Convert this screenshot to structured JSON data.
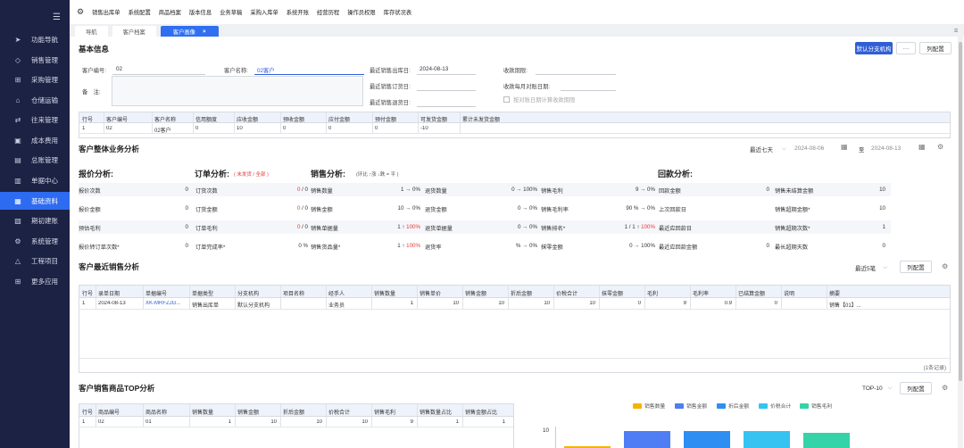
{
  "sidebar": {
    "menu_icon": "hamburger-icon",
    "items": [
      {
        "label": "功能导航",
        "icon": "navigate-icon"
      },
      {
        "label": "销售管理",
        "icon": "tag-icon"
      },
      {
        "label": "采购管理",
        "icon": "cart-icon"
      },
      {
        "label": "仓储运输",
        "icon": "warehouse-icon"
      },
      {
        "label": "往来管理",
        "icon": "transfer-icon"
      },
      {
        "label": "成本费用",
        "icon": "cost-icon"
      },
      {
        "label": "总账管理",
        "icon": "ledger-icon"
      },
      {
        "label": "单据中心",
        "icon": "document-icon"
      },
      {
        "label": "基础资料",
        "icon": "data-icon"
      },
      {
        "label": "期初建账",
        "icon": "opening-icon"
      },
      {
        "label": "系统管理",
        "icon": "settings-icon"
      },
      {
        "label": "工程项目",
        "icon": "project-icon"
      },
      {
        "label": "更多应用",
        "icon": "apps-icon"
      }
    ]
  },
  "topmenu": [
    "销售出库单",
    "系统配置",
    "商品档案",
    "版本信息",
    "业务草稿",
    "采购入库单",
    "系统开账",
    "经营历程",
    "操作员权限",
    "库存状况表"
  ],
  "tabs": [
    {
      "label": "导航"
    },
    {
      "label": "客户档案"
    },
    {
      "label": "客户画像",
      "close": "×"
    }
  ],
  "basic": {
    "title": "基本信息",
    "btn_default": "默认分支机构",
    "btn_more": "···",
    "btn_columns": "列配置",
    "customer_no_label": "客户编号:",
    "customer_no": "02",
    "customer_name_label": "客户名称:",
    "customer_name": "02客户",
    "memo_label": "备　注:",
    "last_out_label": "最近销售出库日:",
    "last_out": "2024-08-13",
    "last_order_label": "最近销售订货日:",
    "last_return_label": "最近销售退货日:",
    "collect_label": "收款期限:",
    "collect_day_label": "收款每月对账日期:",
    "checkbox_label": "按对账日期计算收款期限"
  },
  "summary_table": {
    "headers": [
      "行号",
      "客户编号",
      "客户名称",
      "信用额度",
      "应收金额",
      "预收金额",
      "应付金额",
      "预付金额",
      "可发货金额",
      "累计未发货金额"
    ],
    "rows": [
      [
        "1",
        "02",
        "02客户",
        "0",
        "10",
        "0",
        "0",
        "0",
        "-10",
        ""
      ]
    ]
  },
  "overall": {
    "title": "客户整体业务分析",
    "range_select": "最近七天",
    "date_from": "2024-08-06",
    "date_sep": "至",
    "date_to": "2024-08-13",
    "quote": {
      "title": "报价分析:",
      "items": [
        {
          "label": "报价次数",
          "value": "0"
        },
        {
          "label": "报价金额",
          "value": "0"
        },
        {
          "label": "预估毛利",
          "value": "0"
        },
        {
          "label": "报价转订单次数*",
          "value": "0"
        }
      ]
    },
    "order": {
      "title": "订单分析:",
      "note": "( 未发货 / 全部 )",
      "items": [
        {
          "label": "订货次数",
          "value_red": "0",
          "value_rest": " / 0"
        },
        {
          "label": "订货金额",
          "value_red": "0",
          "value_rest": " / 0"
        },
        {
          "label": "订单毛利",
          "value_red": "0",
          "value_rest": " / 0"
        },
        {
          "label": "订单完成率*",
          "value_red": "",
          "value_rest": "0 %"
        }
      ]
    },
    "sales": {
      "title": "销售分析:",
      "note": "(环比 ↑涨 ↓跌 = 平 )",
      "left": [
        {
          "label": "销售数量",
          "value": "1 → 0%"
        },
        {
          "label": "销售金额",
          "value": "10 → 0%"
        },
        {
          "label": "销售单据量",
          "value": "1 ↑ ",
          "value_red": "100%"
        },
        {
          "label": "销售货品量*",
          "value": "1 ↑ ",
          "value_red": "100%"
        }
      ],
      "mid": [
        {
          "label": "退货数量",
          "value": "0 → 100%"
        },
        {
          "label": "退货金额",
          "value": "0 → 0%"
        },
        {
          "label": "退货单据量",
          "value": "0 → 0%"
        },
        {
          "label": "退货率",
          "value": "% → 0%"
        }
      ],
      "right": [
        {
          "label": "销售毛利",
          "value": "9 → 0%"
        },
        {
          "label": "销售毛利率",
          "value": "90 % → 0%"
        },
        {
          "label": "销售排名*",
          "value": "1 / 1 ↑ ",
          "value_red": "100%"
        },
        {
          "label": "抹零金额",
          "value": "0 → 100%"
        }
      ]
    },
    "receipt": {
      "title": "回款分析:",
      "left": [
        {
          "label": "回款金额",
          "value": "0"
        },
        {
          "label": "上次回款日",
          "value": ""
        },
        {
          "label": "最近应回款日",
          "value": ""
        },
        {
          "label": "最近应回款金额",
          "value": "0"
        }
      ],
      "right": [
        {
          "label": "销售未结算金额",
          "value": "10"
        },
        {
          "label": "销售超期金额*",
          "value": "10"
        },
        {
          "label": "销售超期次数*",
          "value": "1"
        },
        {
          "label": "最长超期天数",
          "value": "0"
        }
      ]
    }
  },
  "recent": {
    "title": "客户最近销售分析",
    "select": "最近5笔",
    "btn_columns": "列配置",
    "headers": [
      "行号",
      "录单日期",
      "单据编号",
      "单据类型",
      "分支机构",
      "项目名称",
      "经手人",
      "销售数量",
      "销售单价",
      "销售金额",
      "折后金额",
      "价税合计",
      "抹零金额",
      "毛利",
      "毛利率",
      "已结算金额",
      "说明",
      "摘要"
    ],
    "rows": [
      [
        "1",
        "2024-08-13",
        "XK-MRFZJG...",
        "销售出库单",
        "默认分支机构",
        "",
        "业务员",
        "1",
        "10",
        "10",
        "10",
        "10",
        "0",
        "9",
        "0.9",
        "0",
        "",
        "销售【01】..."
      ]
    ],
    "footer": "(1条记录)"
  },
  "top": {
    "title": "客户销售商品TOP分析",
    "select": "TOP-10",
    "btn_columns": "列配置",
    "headers": [
      "行号",
      "商品编号",
      "商品名称",
      "销售数量",
      "销售金额",
      "折后金额",
      "价税合计",
      "销售毛利",
      "销售数量占比",
      "销售金额占比"
    ],
    "rows": [
      [
        "1",
        "02",
        "01",
        "1",
        "10",
        "10",
        "10",
        "9",
        "1",
        "1"
      ]
    ]
  },
  "chart_data": {
    "type": "bar",
    "legend": [
      "销售数量",
      "销售金额",
      "折后金额",
      "价税合计",
      "销售毛利"
    ],
    "colors": [
      "#f4b400",
      "#4f7df3",
      "#2f8ef2",
      "#36c3f2",
      "#35d3a8"
    ],
    "y_tick_label": "10",
    "values": [
      1,
      10,
      10,
      10,
      9
    ]
  }
}
